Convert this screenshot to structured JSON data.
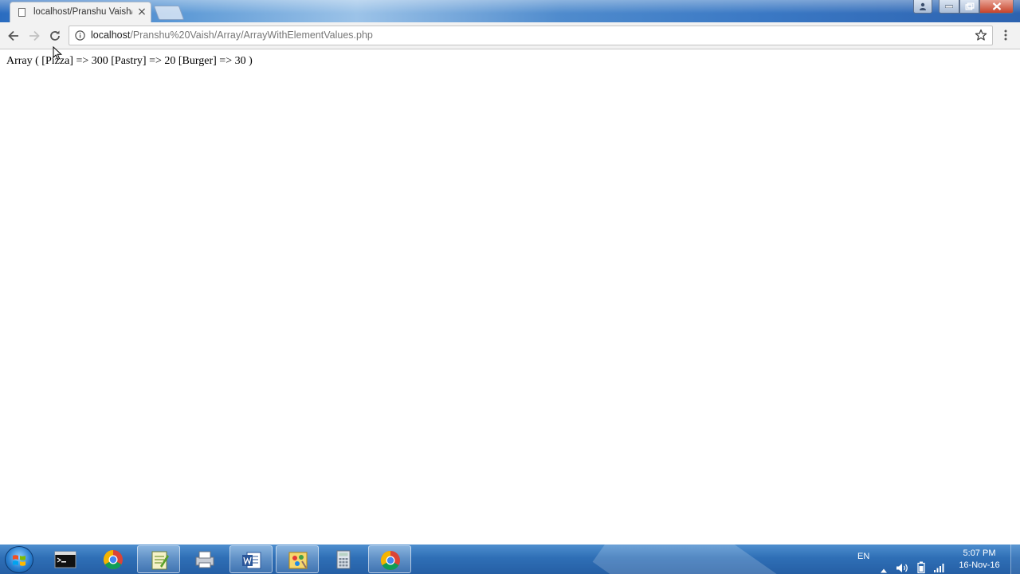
{
  "browser": {
    "tab": {
      "title": "localhost/Pranshu Vaish/",
      "close_glyph": "×"
    },
    "address_bar": {
      "host": "localhost",
      "path": "/Pranshu%20Vaish/Array/ArrayWithElementValues.php"
    },
    "icons": [
      "back-icon",
      "forward-icon",
      "reload-icon",
      "info-icon",
      "star-icon",
      "menu-icon"
    ]
  },
  "page": {
    "output": "Array ( [Pizza] => 300 [Pastry] => 20 [Burger] => 30 )"
  },
  "taskbar": {
    "apps": [
      "command-prompt",
      "chrome",
      "notepad",
      "printer",
      "word",
      "paint",
      "calculator",
      "chrome"
    ],
    "active_app": "chrome",
    "tray": {
      "language": "EN",
      "time": "5:07 PM",
      "date": "16-Nov-16"
    }
  },
  "colors": {
    "taskbar": "#2f6fb6",
    "titlebar": "#4f8bcd",
    "toolbar": "#f2f2f2"
  }
}
